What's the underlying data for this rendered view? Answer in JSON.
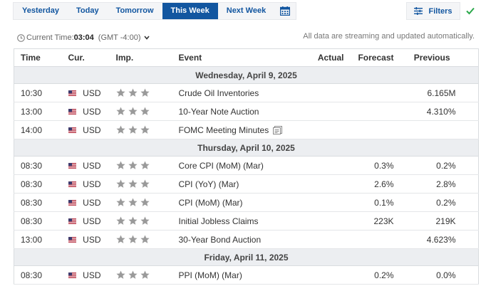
{
  "tabs": [
    {
      "label": "Yesterday",
      "active": false
    },
    {
      "label": "Today",
      "active": false
    },
    {
      "label": "Tomorrow",
      "active": false
    },
    {
      "label": "This Week",
      "active": true
    },
    {
      "label": "Next Week",
      "active": false
    }
  ],
  "calendar_icon": "calendar-icon",
  "filters": {
    "label": "Filters",
    "icon": "sliders-icon"
  },
  "status_icon": "checkmark-icon",
  "status_color": "#2aa84a",
  "accent_color": "#1256a0",
  "time_bar": {
    "label": "Current Time:",
    "time": "03:04",
    "timezone": "(GMT -4:00)"
  },
  "streaming_note": "All data are streaming and updated automatically.",
  "table": {
    "headers": {
      "time": "Time",
      "currency": "Cur.",
      "importance": "Imp.",
      "event": "Event",
      "actual": "Actual",
      "forecast": "Forecast",
      "previous": "Previous"
    },
    "days": [
      {
        "label": "Wednesday, April 9, 2025",
        "events": [
          {
            "time": "10:30",
            "currency": "USD",
            "importance": 3,
            "event": "Crude Oil Inventories",
            "actual": "",
            "forecast": "",
            "previous": "6.165M",
            "has_doc": false
          },
          {
            "time": "13:00",
            "currency": "USD",
            "importance": 3,
            "event": "10-Year Note Auction",
            "actual": "",
            "forecast": "",
            "previous": "4.310%",
            "has_doc": false
          },
          {
            "time": "14:00",
            "currency": "USD",
            "importance": 3,
            "event": "FOMC Meeting Minutes",
            "actual": "",
            "forecast": "",
            "previous": "",
            "has_doc": true
          }
        ]
      },
      {
        "label": "Thursday, April 10, 2025",
        "events": [
          {
            "time": "08:30",
            "currency": "USD",
            "importance": 3,
            "event": "Core CPI (MoM) (Mar)",
            "actual": "",
            "forecast": "0.3%",
            "previous": "0.2%",
            "has_doc": false
          },
          {
            "time": "08:30",
            "currency": "USD",
            "importance": 3,
            "event": "CPI (YoY) (Mar)",
            "actual": "",
            "forecast": "2.6%",
            "previous": "2.8%",
            "has_doc": false
          },
          {
            "time": "08:30",
            "currency": "USD",
            "importance": 3,
            "event": "CPI (MoM) (Mar)",
            "actual": "",
            "forecast": "0.1%",
            "previous": "0.2%",
            "has_doc": false
          },
          {
            "time": "08:30",
            "currency": "USD",
            "importance": 3,
            "event": "Initial Jobless Claims",
            "actual": "",
            "forecast": "223K",
            "previous": "219K",
            "has_doc": false
          },
          {
            "time": "13:00",
            "currency": "USD",
            "importance": 3,
            "event": "30-Year Bond Auction",
            "actual": "",
            "forecast": "",
            "previous": "4.623%",
            "has_doc": false
          }
        ]
      },
      {
        "label": "Friday, April 11, 2025",
        "events": [
          {
            "time": "08:30",
            "currency": "USD",
            "importance": 3,
            "event": "PPI (MoM) (Mar)",
            "actual": "",
            "forecast": "0.2%",
            "previous": "0.0%",
            "has_doc": false
          }
        ]
      }
    ]
  }
}
